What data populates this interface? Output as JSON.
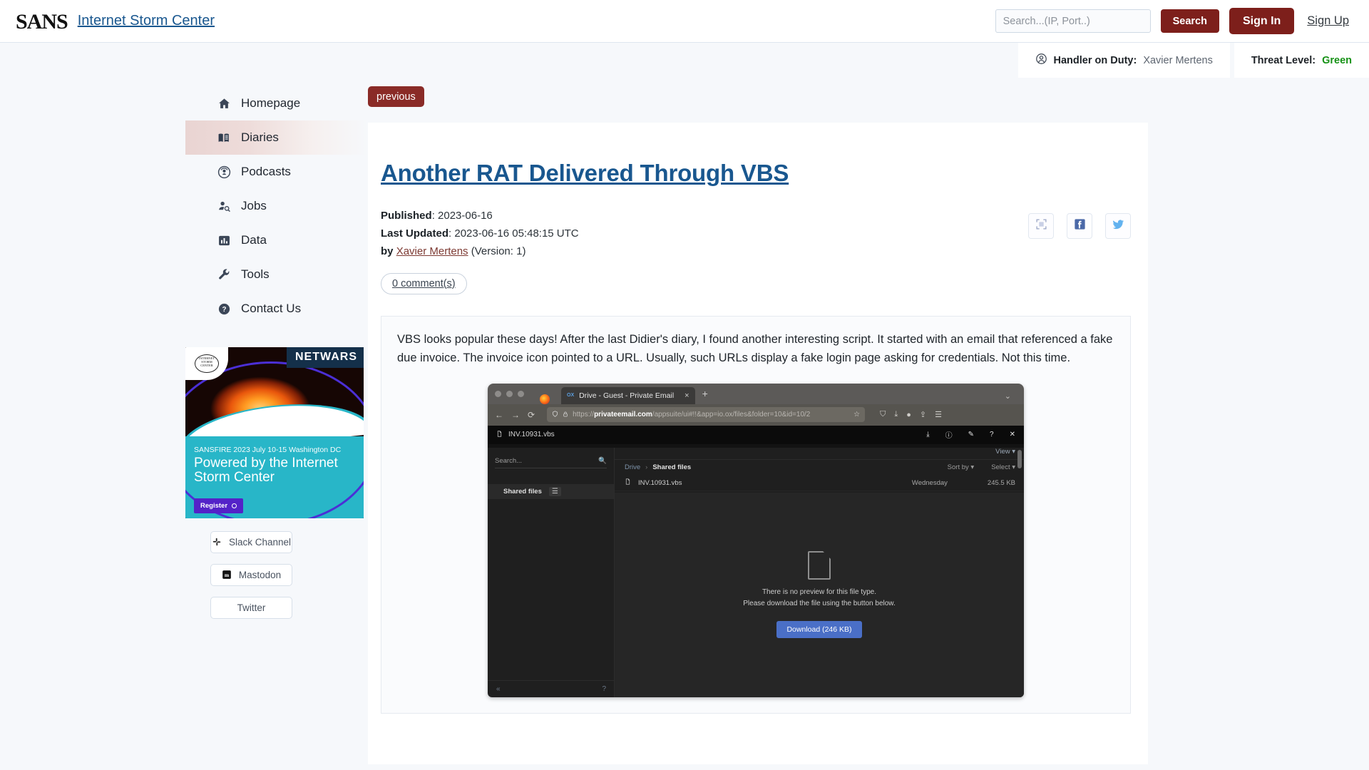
{
  "header": {
    "logo_text": "SANS",
    "brand_link": "Internet Storm Center",
    "search_placeholder": "Search...(IP, Port..)",
    "search_value": "",
    "search_button": "Search",
    "sign_in": "Sign In",
    "sign_up": "Sign Up"
  },
  "status": {
    "handler_label": "Handler on Duty:",
    "handler_value": "Xavier Mertens",
    "threat_label": "Threat Level:",
    "threat_value": "Green",
    "threat_color": "#169216"
  },
  "sidebar": {
    "items": [
      {
        "label": "Homepage",
        "icon": "home-icon",
        "active": false
      },
      {
        "label": "Diaries",
        "icon": "book-icon",
        "active": true
      },
      {
        "label": "Podcasts",
        "icon": "podcast-icon",
        "active": false
      },
      {
        "label": "Jobs",
        "icon": "user-search-icon",
        "active": false
      },
      {
        "label": "Data",
        "icon": "chart-icon",
        "active": false
      },
      {
        "label": "Tools",
        "icon": "wrench-icon",
        "active": false
      },
      {
        "label": "Contact Us",
        "icon": "question-circle-icon",
        "active": false
      }
    ],
    "promo": {
      "netwars": "NETWARS",
      "seal": "INTERNET STORM CENTER",
      "subtitle": "SANSFIRE 2023 July 10-15 Washington DC",
      "headline": "Powered by the Internet Storm Center",
      "register": "Register"
    },
    "social": [
      {
        "label": "Slack Channel",
        "icon": "slack-icon"
      },
      {
        "label": "Mastodon",
        "icon": "mastodon-icon"
      },
      {
        "label": "Twitter",
        "icon": "twitter-icon"
      }
    ]
  },
  "main": {
    "previous_button": "previous",
    "title": "Another RAT Delivered Through VBS",
    "published_label": "Published",
    "published_value": ": 2023-06-16",
    "updated_label": "Last Updated",
    "updated_value": ": 2023-06-16 05:48:15 UTC",
    "by_label": "by",
    "author": "Xavier Mertens",
    "version": "(Version: 1)",
    "comments": "0 comment(s)",
    "share": [
      {
        "name": "fullscreen-icon"
      },
      {
        "name": "facebook-icon"
      },
      {
        "name": "twitter-icon"
      }
    ],
    "paragraph": "VBS looks popular these days! After the last Didier's diary, I found another interesting script. It started with an email that referenced a fake due invoice. The invoice icon pointed to a URL. Usually, such URLs display a fake login page asking for credentials. Not this time."
  },
  "screenshot": {
    "tab_title": "Drive - Guest - Private Email",
    "tab_favicon": "OX",
    "tab_close": "×",
    "new_tab": "+",
    "chevron": "⌄",
    "back": "←",
    "forward": "→",
    "reload": "⟳",
    "shield": "⬠",
    "lock": "🔒",
    "url_scheme": "https://",
    "url_domain": "privateemail.com",
    "url_path": "/appsuite/ui#!!&app=io.ox/files&folder=10&id=10/2",
    "star": "☆",
    "toolbar_icons": [
      "pocket-icon",
      "downloads-icon",
      "account-icon",
      "share-icon",
      "menu-icon"
    ],
    "file_bar_name": "INV.10931.vbs",
    "file_bar_actions": [
      "download-icon",
      "info-icon",
      "edit-icon",
      "help-icon",
      "close-icon"
    ],
    "left_search_placeholder": "Search...",
    "left_search_icon": "🔍",
    "folder_name": "Shared files",
    "folder_menu": "☰",
    "left_collapse": "«",
    "left_help": "?",
    "view_label": "View ▾",
    "crumb_root": "Drive",
    "crumb_sep": "›",
    "crumb_current": "Shared files",
    "sort_by": "Sort by ▾",
    "select": "Select ▾",
    "file_name": "INV.10931.vbs",
    "file_date": "Wednesday",
    "file_size": "245.5 KB",
    "preview_line1": "There is no preview for this file type.",
    "preview_line2": "Please download the file using the button below.",
    "download_button": "Download (246 KB)"
  },
  "colors": {
    "brand_red": "#7d1f1b",
    "link_blue": "#19578f",
    "page_bg": "#f6f8fb"
  }
}
